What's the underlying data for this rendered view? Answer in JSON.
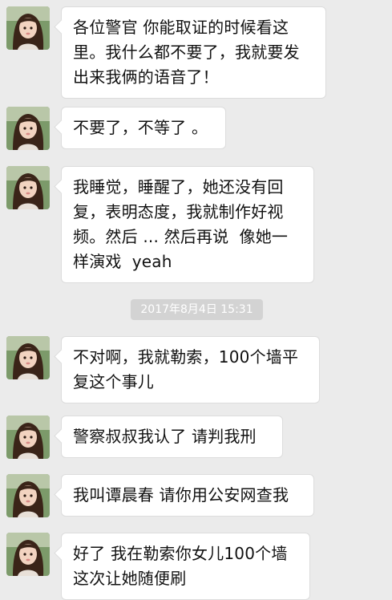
{
  "chat": {
    "background_color": "#ebebeb",
    "timestamp": "2017年8月4日 15:31",
    "messages": [
      {
        "sender": "other",
        "avatar_icon": "girl-avatar-icon",
        "text": "各位警官 你能取证的时候看这\n里。我什么都不要了，我就要发\n出来我俩的语音了！"
      },
      {
        "sender": "other",
        "avatar_icon": "girl-avatar-icon",
        "text": "不要了，不等了 。"
      },
      {
        "sender": "other",
        "avatar_icon": "girl-avatar-icon",
        "text": "我睡觉，睡醒了，她还没有回\n复，表明态度，我就制作好视\n频。然后 ... 然后再说  像她一\n样演戏  yeah"
      },
      {
        "sender": "other",
        "avatar_icon": "girl-avatar-icon",
        "text": "不对啊，我就勒索，100个墙平\n复这个事儿"
      },
      {
        "sender": "other",
        "avatar_icon": "girl-avatar-icon",
        "text": "警察叔叔我认了 请判我刑"
      },
      {
        "sender": "other",
        "avatar_icon": "girl-avatar-icon",
        "text": "我叫谭晨春 请你用公安网查我"
      },
      {
        "sender": "other",
        "avatar_icon": "girl-avatar-icon",
        "text": "好了 我在勒索你女儿100个墙\n这次让她随便刷"
      }
    ]
  }
}
